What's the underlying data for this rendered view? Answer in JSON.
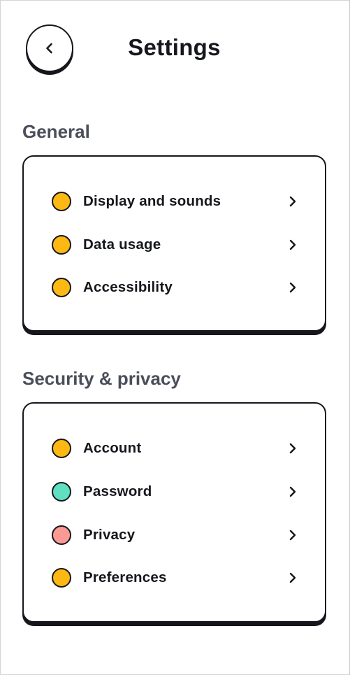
{
  "header": {
    "title": "Settings",
    "back_icon": "chevron-left-icon"
  },
  "sections": [
    {
      "title": "General",
      "items": [
        {
          "label": "Display and sounds",
          "color": "#fdb813",
          "icon": "chevron-right-icon"
        },
        {
          "label": "Data usage",
          "color": "#fdb813",
          "icon": "chevron-right-icon"
        },
        {
          "label": "Accessibility",
          "color": "#fdb813",
          "icon": "chevron-right-icon"
        }
      ]
    },
    {
      "title": "Security & privacy",
      "items": [
        {
          "label": "Account",
          "color": "#fdb813",
          "icon": "chevron-right-icon"
        },
        {
          "label": "Password",
          "color": "#5fe0c0",
          "icon": "chevron-right-icon"
        },
        {
          "label": "Privacy",
          "color": "#fb9a94",
          "icon": "chevron-right-icon"
        },
        {
          "label": "Preferences",
          "color": "#fdb813",
          "icon": "chevron-right-icon"
        }
      ]
    }
  ],
  "colors": {
    "ink": "#15171c",
    "section_title": "#4b4e5a",
    "background": "#ffffff"
  }
}
